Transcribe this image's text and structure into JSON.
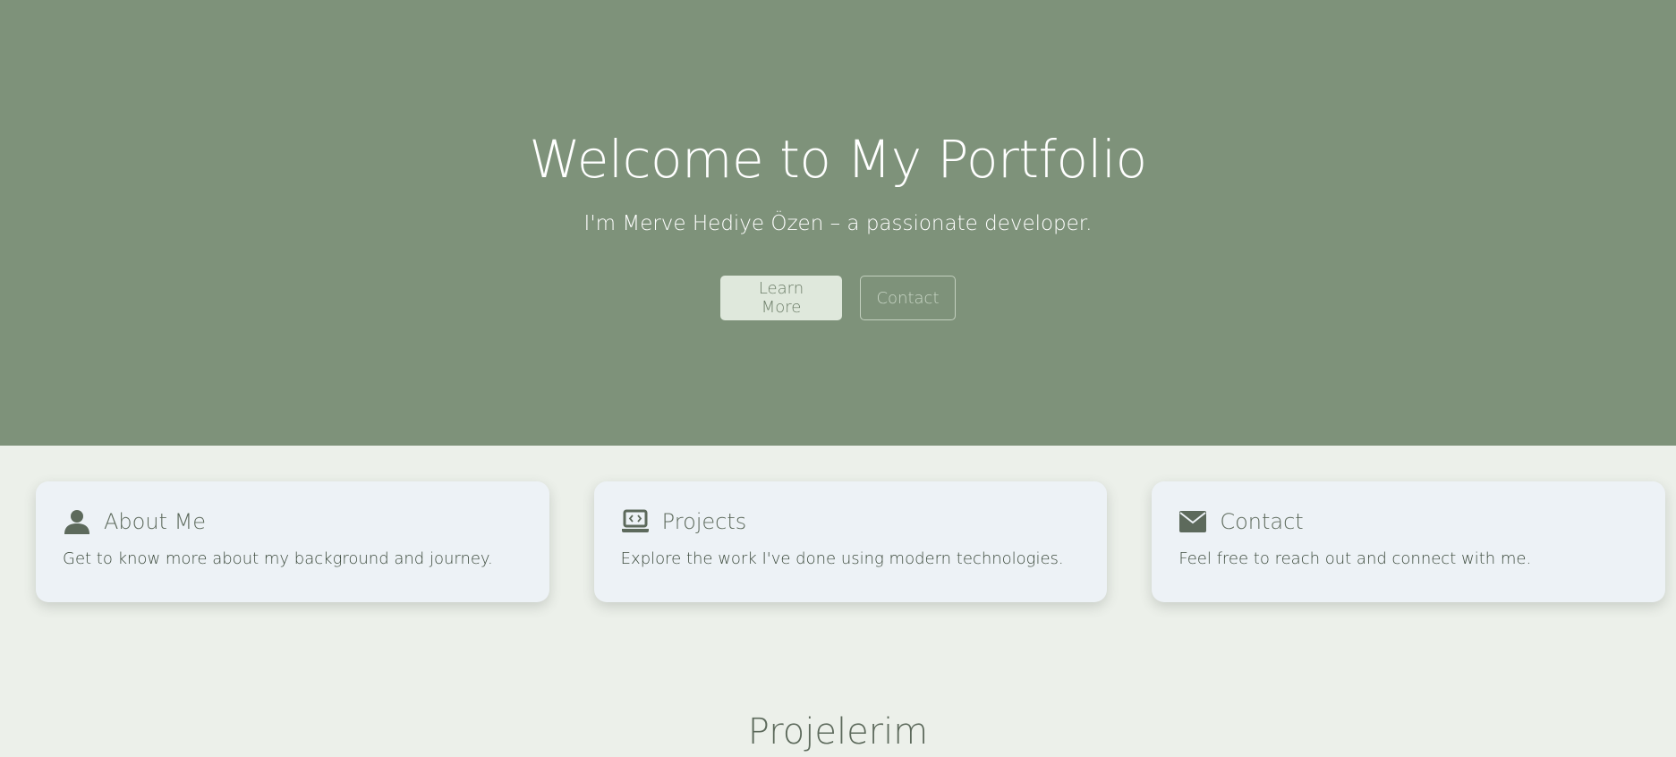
{
  "hero": {
    "title": "Welcome to My Portfolio",
    "subtitle": "I'm Merve Hediye Özen – a passionate developer.",
    "learn_more_label": "Learn More",
    "contact_label": "Contact"
  },
  "cards": [
    {
      "icon": "user-icon",
      "title": "About Me",
      "text": "Get to know more about my background and journey."
    },
    {
      "icon": "laptop-code-icon",
      "title": "Projects",
      "text": "Explore the work I've done using modern technologies."
    },
    {
      "icon": "envelope-icon",
      "title": "Contact",
      "text": "Feel free to reach out and connect with me."
    }
  ],
  "projects_section": {
    "title": "Projelerim"
  },
  "colors": {
    "hero_bg": "#7e927a",
    "page_bg": "#ecf0ea",
    "card_bg": "#edf2f6",
    "accent_text": "#5d6a5c",
    "learn_more_bg": "#dfe8dc"
  }
}
